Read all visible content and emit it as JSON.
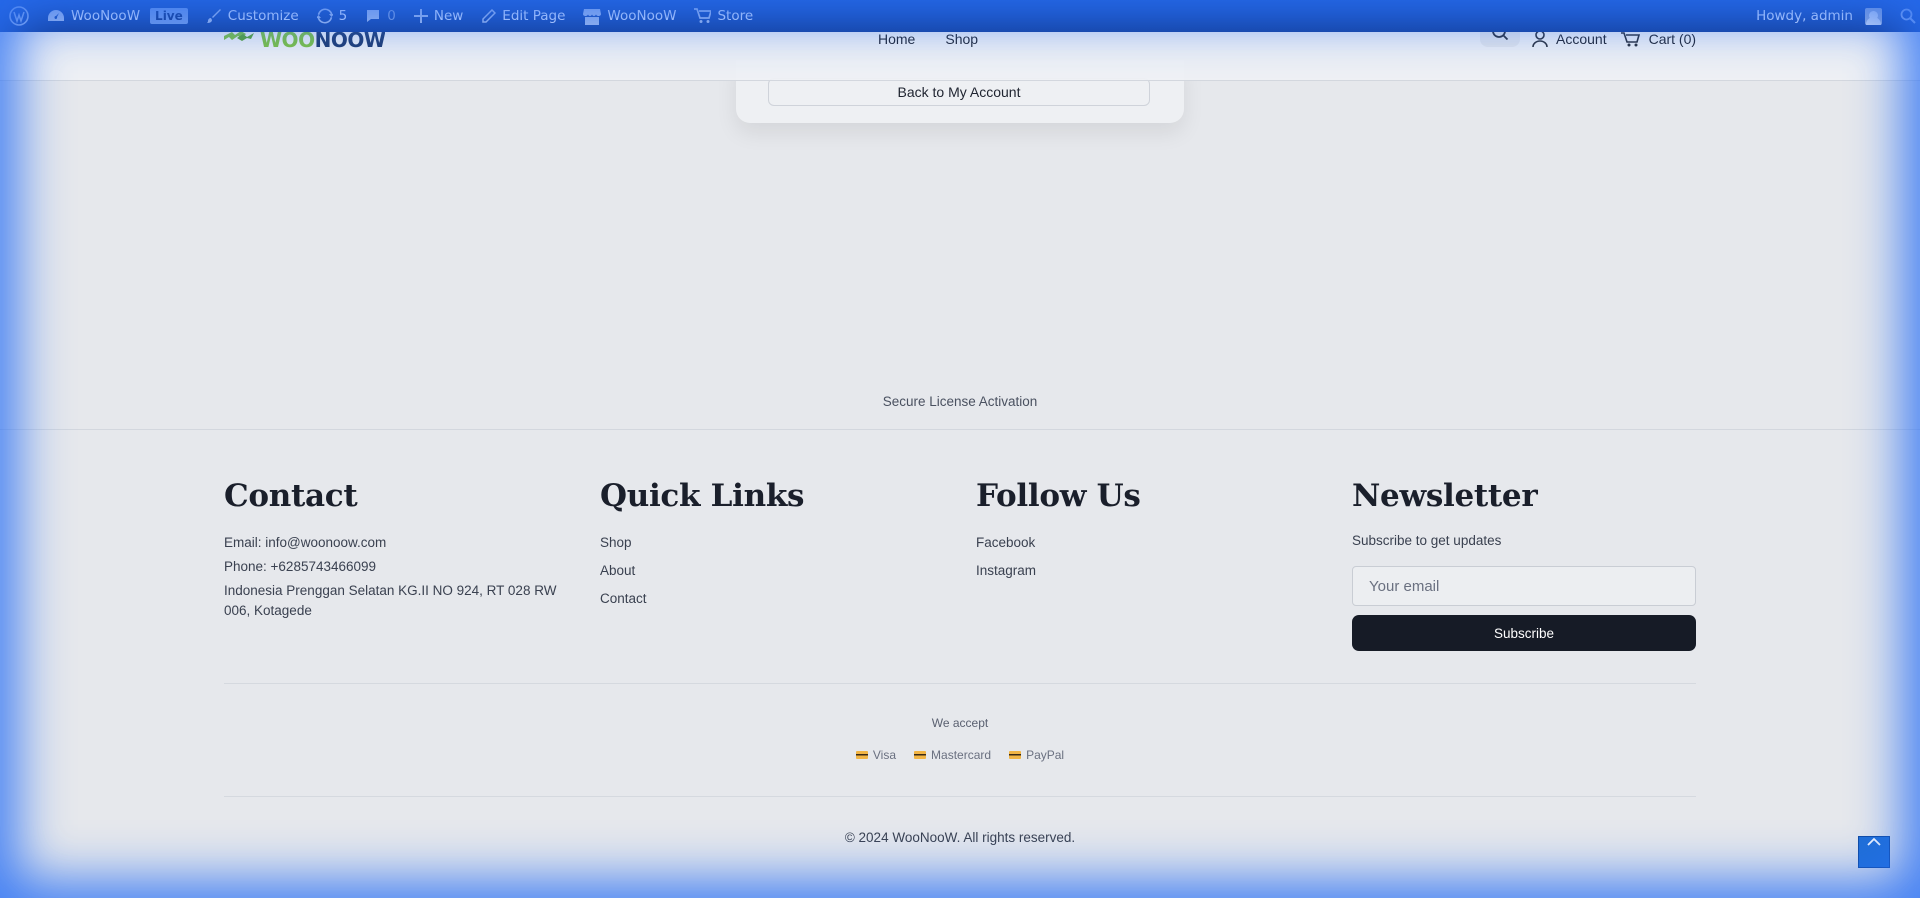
{
  "adminbar": {
    "site_name": "WooNooW",
    "live_badge": "Live",
    "customize": "Customize",
    "updates_count": "5",
    "comments_count": "0",
    "new_label": "New",
    "edit_page": "Edit Page",
    "woonoow": "WooNooW",
    "store": "Store",
    "howdy": "Howdy, admin"
  },
  "header": {
    "logo_part1": "WOO",
    "logo_part2": "NOOW",
    "nav": [
      "Home",
      "Shop"
    ],
    "account": "Account",
    "cart": "Cart (0)"
  },
  "card": {
    "back_button": "Back to My Account"
  },
  "secure_text": "Secure License Activation",
  "footer": {
    "contact": {
      "title": "Contact",
      "email": "Email: info@woonoow.com",
      "phone": "Phone: +6285743466099",
      "address": "Indonesia Prenggan Selatan KG.II NO 924, RT 028 RW 006, Kotagede"
    },
    "quick_links": {
      "title": "Quick Links",
      "items": [
        "Shop",
        "About",
        "Contact"
      ]
    },
    "follow": {
      "title": "Follow Us",
      "items": [
        "Facebook",
        "Instagram"
      ]
    },
    "newsletter": {
      "title": "Newsletter",
      "subtitle": "Subscribe to get updates",
      "placeholder": "Your email",
      "button": "Subscribe"
    },
    "we_accept": "We accept",
    "payments": [
      "Visa",
      "Mastercard",
      "PayPal"
    ],
    "copyright": "© 2024 WooNooW. All rights reserved."
  },
  "colors": {
    "accent": "#1f6fd6",
    "adminbar": "#1a4fb8",
    "button_dark": "#161b26",
    "logo_green": "#7dc142",
    "logo_navy": "#1f3b70"
  }
}
